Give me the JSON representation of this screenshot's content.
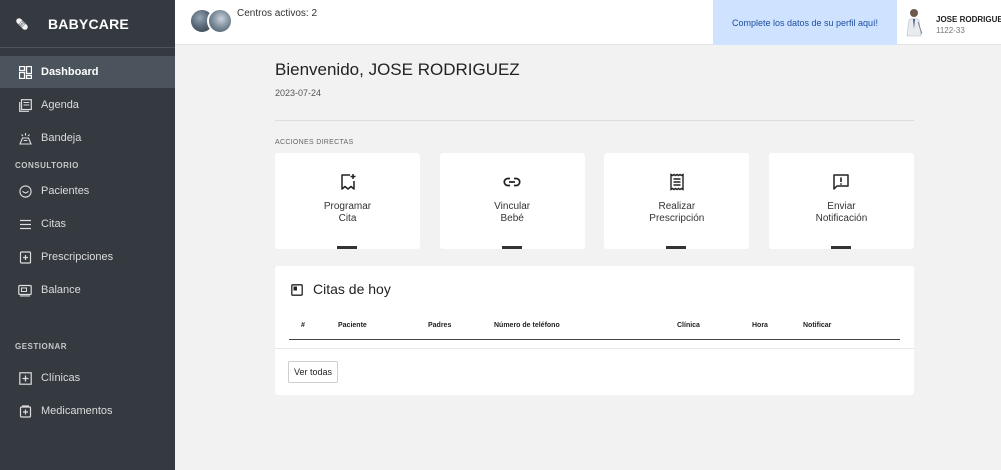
{
  "brand": {
    "name": "BABYCARE"
  },
  "sidebar": {
    "items": [
      {
        "label": "Dashboard",
        "icon": "dashboard-icon",
        "active": true
      },
      {
        "label": "Agenda",
        "icon": "calendar-icon"
      },
      {
        "label": "Bandeja",
        "icon": "inbox-icon"
      }
    ],
    "section_consultorio": "CONSULTORIO",
    "consultorio_items": [
      {
        "label": "Pacientes",
        "icon": "face-icon"
      },
      {
        "label": "Citas",
        "icon": "list-icon"
      },
      {
        "label": "Prescripciones",
        "icon": "prescription-icon"
      },
      {
        "label": "Balance",
        "icon": "wallet-icon"
      }
    ],
    "section_gestionar": "GESTIONAR",
    "gestionar_items": [
      {
        "label": "Clínicas",
        "icon": "plus-box-icon"
      },
      {
        "label": "Medicamentos",
        "icon": "medicine-icon"
      }
    ]
  },
  "topbar": {
    "centros_text": "Centros activos: 2",
    "profile_alert": "Complete los datos de su perfil aquí!",
    "user_name": "JOSE RODRIGUEZ",
    "user_id": "1122-33"
  },
  "main": {
    "welcome": "Bienvenido, JOSE RODRIGUEZ",
    "date": "2023-07-24",
    "section_label": "ACCIONES DIRECTAS",
    "actions": [
      {
        "label": "Programar\nCita",
        "icon": "calendar-add-icon"
      },
      {
        "label": "Vincular\nBebé",
        "icon": "link-icon"
      },
      {
        "label": "Realizar\nPrescripción",
        "icon": "receipt-icon"
      },
      {
        "label": "Enviar\nNotificación",
        "icon": "alert-message-icon"
      }
    ],
    "today": {
      "title": "Citas de hoy",
      "columns": [
        "#",
        "Paciente",
        "Padres",
        "Número de teléfono",
        "Clínica",
        "Hora",
        "Notificar"
      ],
      "view_all": "Ver todas"
    }
  }
}
